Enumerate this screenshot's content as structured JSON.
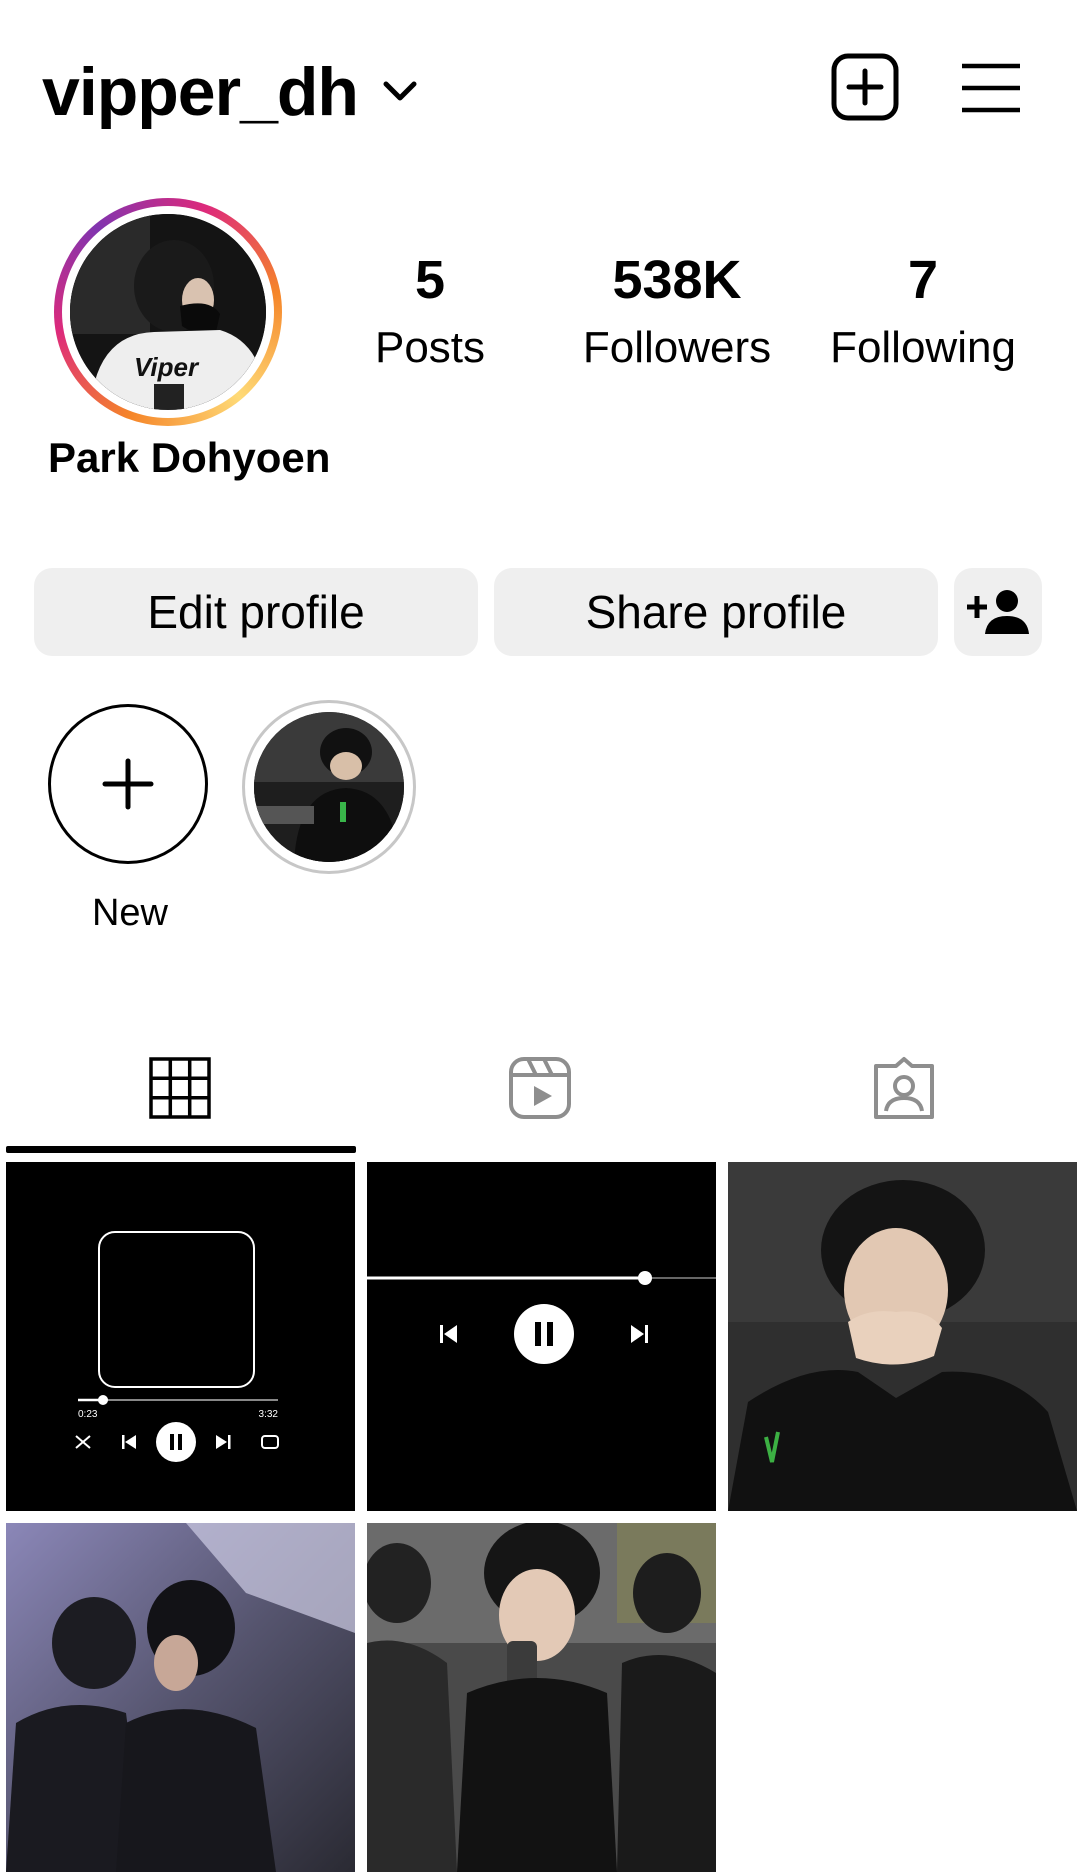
{
  "header": {
    "username": "vipper_dh",
    "icons": [
      "chevron-down-icon",
      "new-post-icon",
      "menu-icon"
    ]
  },
  "profile": {
    "full_name": "Park Dohyoen",
    "avatar_jersey_text": "Viper"
  },
  "stats": {
    "posts": {
      "count": "5",
      "label": "Posts"
    },
    "followers": {
      "count": "538K",
      "label": "Followers"
    },
    "following": {
      "count": "7",
      "label": "Following"
    }
  },
  "actions": {
    "edit_label": "Edit profile",
    "share_label": "Share profile",
    "discover_icon": "add-person-icon"
  },
  "highlights": {
    "new_label": "New"
  },
  "tabs": [
    {
      "name": "posts",
      "icon": "grid-icon",
      "selected": true
    },
    {
      "name": "reels",
      "icon": "reels-icon",
      "selected": false
    },
    {
      "name": "tagged",
      "icon": "tagged-icon",
      "selected": false
    }
  ],
  "posts": [
    {
      "kind": "music-player",
      "elapsed": "0:23",
      "total": "3:32"
    },
    {
      "kind": "music-player-minimal"
    },
    {
      "kind": "photo"
    },
    {
      "kind": "photo"
    },
    {
      "kind": "photo"
    }
  ],
  "colors": {
    "button_bg": "#efefef",
    "ring_gradient": [
      "#f58529",
      "#dd2a7b",
      "#8134af"
    ],
    "tab_inactive": "#8e8e8e"
  }
}
